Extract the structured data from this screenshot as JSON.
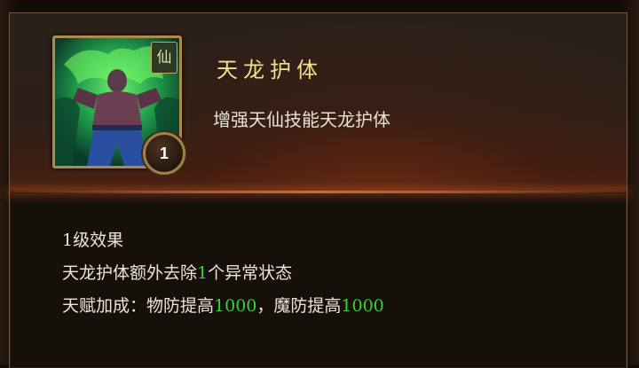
{
  "skill": {
    "name": "天龙护体",
    "description": "增强天仙技能天龙护体",
    "class_badge": "仙",
    "level": "1",
    "icon": "dragon-warrior-skill-icon"
  },
  "effects": {
    "header_num": "1",
    "header_text": "级效果",
    "line1_pre": "天龙护体额外去除",
    "line1_value": "1",
    "line1_post": "个异常状态",
    "line2_pre": "天赋加成：物防提高",
    "line2_value1": "1000",
    "line2_mid": "，魔防提高",
    "line2_value2": "1000"
  },
  "colors": {
    "title": "#f3df8c",
    "highlight": "#32d432",
    "text": "#ece6d6",
    "border": "#b08a4a"
  }
}
